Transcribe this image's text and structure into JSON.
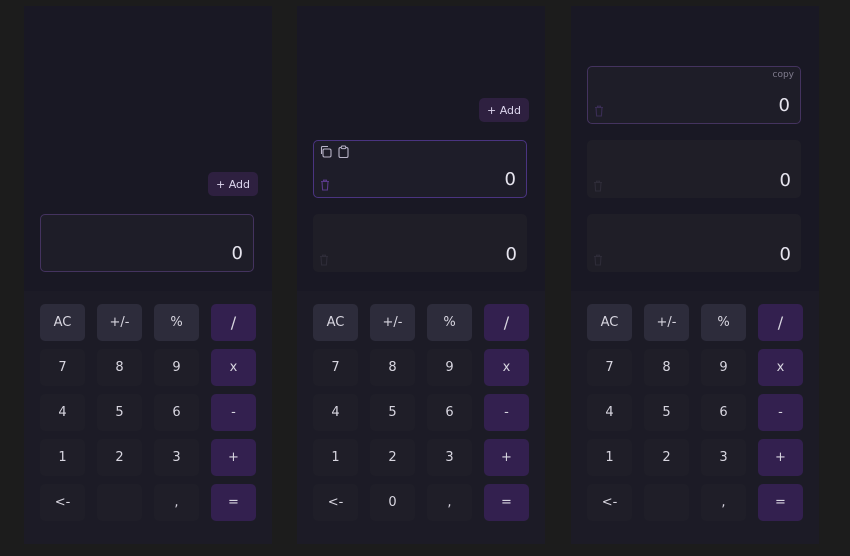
{
  "add_label": "+ Add",
  "copy_label": "copy",
  "keys": {
    "ac": "AC",
    "sign": "+/-",
    "percent": "%",
    "divide": "/",
    "seven": "7",
    "eight": "8",
    "nine": "9",
    "multiply": "x",
    "four": "4",
    "five": "5",
    "six": "6",
    "minus": "-",
    "one": "1",
    "two": "2",
    "three": "3",
    "plus": "+",
    "back": "<-",
    "zero": "0",
    "comma": ",",
    "equals": "="
  },
  "panels": [
    {
      "zero_key": "",
      "displays": [
        {
          "value": "0"
        }
      ]
    },
    {
      "zero_key": "0",
      "displays": [
        {
          "value": "0"
        },
        {
          "value": "0"
        }
      ]
    },
    {
      "zero_key": "",
      "displays": [
        {
          "value": "0"
        },
        {
          "value": "0"
        },
        {
          "value": "0"
        }
      ]
    }
  ],
  "colors": {
    "background": "#1c1c1c",
    "panel": "#191824",
    "function_key": "#2d2c3b",
    "operator_key": "#33204f",
    "accent_border": "#4a3480"
  },
  "icons": [
    "trash-icon",
    "copy-icon",
    "clipboard-icon"
  ]
}
